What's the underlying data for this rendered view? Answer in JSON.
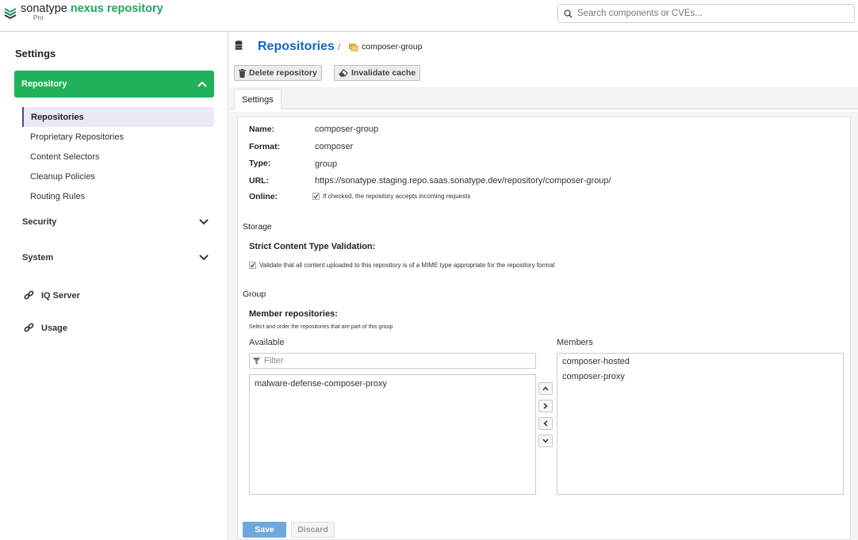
{
  "header": {
    "brand_plain": "sonatype",
    "brand_product": "nexus repository",
    "edition": "Pro",
    "search_placeholder": "Search components or CVEs..."
  },
  "sidebar": {
    "title": "Settings",
    "repository_label": "Repository",
    "repository_items": [
      {
        "label": "Repositories",
        "active": true
      },
      {
        "label": "Proprietary Repositories",
        "active": false
      },
      {
        "label": "Content Selectors",
        "active": false
      },
      {
        "label": "Cleanup Policies",
        "active": false
      },
      {
        "label": "Routing Rules",
        "active": false
      }
    ],
    "security_label": "Security",
    "system_label": "System",
    "iq_server_label": "IQ Server",
    "usage_label": "Usage"
  },
  "breadcrumb": {
    "title": "Repositories",
    "separator": "/",
    "current": "composer-group"
  },
  "toolbar": {
    "delete_label": "Delete repository",
    "invalidate_label": "Invalidate cache"
  },
  "tabs": {
    "settings_label": "Settings"
  },
  "form": {
    "name_label": "Name:",
    "name_value": "composer-group",
    "format_label": "Format:",
    "format_value": "composer",
    "type_label": "Type:",
    "type_value": "group",
    "url_label": "URL:",
    "url_value": "https://sonatype.staging.repo.saas.sonatype.dev/repository/composer-group/",
    "online_label": "Online:",
    "online_checked": true,
    "online_help": "If checked, the repository accepts incoming requests",
    "storage_heading": "Storage",
    "strict_label": "Strict Content Type Validation:",
    "strict_checked": true,
    "strict_help": "Validate that all content uploaded to this repository is of a MIME type appropriate for the repository format",
    "group_heading": "Group",
    "members_label": "Member repositories:",
    "members_help": "Select and order the repositories that are part of this group",
    "available_label": "Available",
    "members_col_label": "Members",
    "filter_placeholder": "Filter",
    "available_items": [
      "malware-defense-composer-proxy"
    ],
    "member_items": [
      "composer-hosted",
      "composer-proxy"
    ],
    "arrow_up": "up",
    "arrow_right": "add",
    "arrow_left": "remove",
    "arrow_down": "down",
    "save_label": "Save",
    "discard_label": "Discard"
  },
  "colors": {
    "brand_green": "#1ea761",
    "sidebar_active": "#1fb25a",
    "link_blue": "#1565c0",
    "save_blue": "#6fa8dc"
  }
}
